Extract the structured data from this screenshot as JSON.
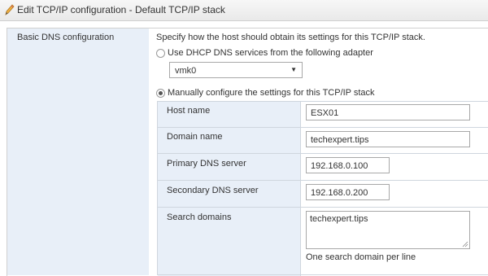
{
  "window": {
    "title": "Edit TCP/IP configuration - Default TCP/IP stack",
    "icon": "pencil-icon"
  },
  "dns": {
    "section_label": "Basic DNS configuration",
    "description": "Specify how the host should obtain its settings for this TCP/IP stack.",
    "option_dhcp": {
      "label": "Use DHCP DNS services from the following adapter",
      "selected": false
    },
    "adapter_select": {
      "value": "vmk0"
    },
    "option_manual": {
      "label": "Manually configure the settings for this TCP/IP stack",
      "selected": true
    }
  },
  "fields": {
    "host_name": {
      "label": "Host name",
      "value": "ESX01"
    },
    "domain_name": {
      "label": "Domain name",
      "value": "techexpert.tips"
    },
    "primary_dns": {
      "label": "Primary DNS server",
      "value": "192.168.0.100"
    },
    "secondary_dns": {
      "label": "Secondary DNS server",
      "value": "192.168.0.200"
    },
    "search_domains": {
      "label": "Search domains",
      "value": "techexpert.tips",
      "hint": "One search domain per line"
    }
  },
  "colors": {
    "label_column_bg": "#e8eff8",
    "title_bar_bg": "#eeeeee",
    "pencil_icon": "#e0a030"
  }
}
